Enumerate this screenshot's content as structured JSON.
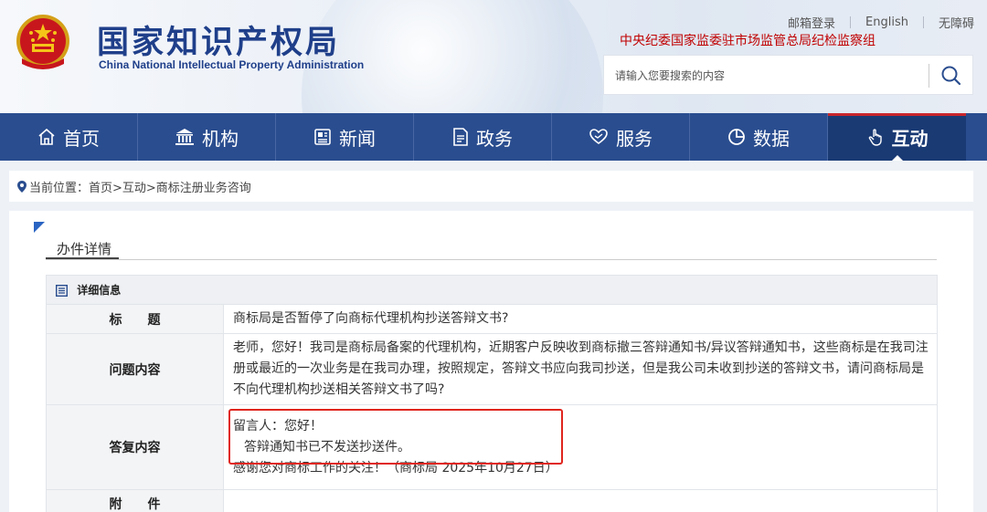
{
  "header": {
    "title_cn": "国家知识产权局",
    "title_en": "China National Intellectual Property Administration",
    "top_links": [
      "邮箱登录",
      "English",
      "无障碍"
    ],
    "supervision": "中央纪委国家监委驻市场监管总局纪检监察组",
    "search": {
      "placeholder": "请输入您要搜索的内容",
      "value": ""
    }
  },
  "nav": {
    "items": [
      {
        "label": "首页",
        "icon": "home-icon"
      },
      {
        "label": "机构",
        "icon": "institution-icon"
      },
      {
        "label": "新闻",
        "icon": "news-icon"
      },
      {
        "label": "政务",
        "icon": "document-icon"
      },
      {
        "label": "服务",
        "icon": "heart-hand-icon"
      },
      {
        "label": "数据",
        "icon": "pie-chart-icon"
      },
      {
        "label": "互动",
        "icon": "hand-pointer-icon"
      }
    ],
    "active": "互动"
  },
  "breadcrumb": {
    "text": "当前位置：首页>互动>商标注册业务咨询"
  },
  "main": {
    "tab": "办件详情",
    "section_title": "详细信息",
    "rows": [
      {
        "label": "标　　题",
        "value": "商标局是否暂停了向商标代理机构抄送答辩文书?"
      },
      {
        "label": "问题内容",
        "value": "老师，您好！我司是商标局备案的代理机构，近期客户反映收到商标撤三答辩通知书/异议答辩通知书，这些商标是在我司注册或最近的一次业务是在我司办理，按照规定，答辩文书应向我司抄送，但是我公司未收到抄送的答辩文书，请问商标局是不向代理机构抄送相关答辩文书了吗?"
      },
      {
        "label": "答复内容",
        "lines": [
          "留言人：您好！",
          "答辩通知书已不发送抄送件。",
          "感谢您对商标工作的关注！（商标局 2025年10月27日）"
        ]
      },
      {
        "label": "附　　件",
        "value": ""
      }
    ]
  },
  "colors": {
    "nav_bg": "#2a4d8f",
    "nav_active": "#1a3a74",
    "highlight": "#e0251e",
    "supervision": "#c00000"
  }
}
